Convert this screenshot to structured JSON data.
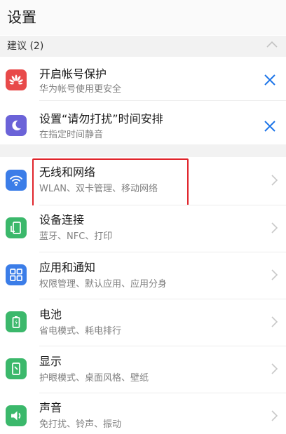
{
  "header": {
    "title": "设置"
  },
  "suggestions": {
    "title": "建议 (2)",
    "items": [
      {
        "title": "开启帐号保护",
        "subtitle": "华为帐号使用更安全",
        "icon": "huawei-logo-icon",
        "color": "#e84a4a"
      },
      {
        "title": "设置“请勿打扰”时间安排",
        "subtitle": "在指定时间静音",
        "icon": "moon-icon",
        "color": "#6b63d8"
      }
    ]
  },
  "settings": {
    "items": [
      {
        "title": "无线和网络",
        "subtitle": "WLAN、双卡管理、移动网络",
        "icon": "wifi-icon",
        "color": "#3b7de8"
      },
      {
        "title": "设备连接",
        "subtitle": "蓝牙、NFC、打印",
        "icon": "device-connection-icon",
        "color": "#3bb86b"
      },
      {
        "title": "应用和通知",
        "subtitle": "权限管理、默认应用、应用分身",
        "icon": "apps-grid-icon",
        "color": "#3b7de8"
      },
      {
        "title": "电池",
        "subtitle": "省电模式、耗电排行",
        "icon": "battery-icon",
        "color": "#3bb86b"
      },
      {
        "title": "显示",
        "subtitle": "护眼模式、桌面风格、壁纸",
        "icon": "display-icon",
        "color": "#3bb86b"
      },
      {
        "title": "声音",
        "subtitle": "免打扰、铃声、振动",
        "icon": "speaker-icon",
        "color": "#3bb86b"
      }
    ]
  },
  "colors": {
    "accent": "#1a73e8",
    "highlight_border": "#e0242b"
  }
}
